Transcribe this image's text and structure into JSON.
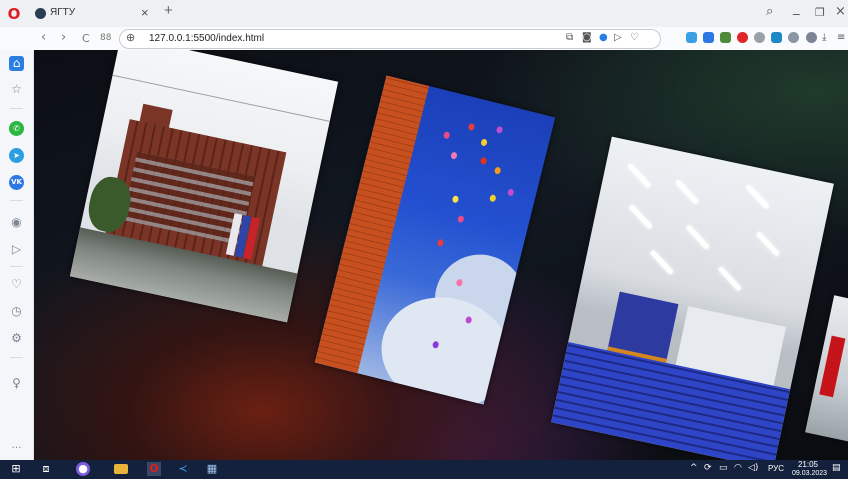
{
  "browser": {
    "tab_title": "ЯГТУ",
    "tab_close": "×",
    "new_tab": "+",
    "url": "127.0.0.1:5500/index.html",
    "window_controls": {
      "search": "⌕",
      "minimize": "_",
      "restore": "❐",
      "close": "×"
    },
    "nav": {
      "back": "‹",
      "forward": "›",
      "reload": "C",
      "speed_dial": "88"
    }
  },
  "sidebar": {
    "items": [
      {
        "name": "home-icon",
        "glyph": "⌂"
      },
      {
        "name": "star-icon",
        "glyph": "☆"
      },
      {
        "name": "whatsapp-icon",
        "glyph": "✆"
      },
      {
        "name": "telegram-icon",
        "glyph": "➤"
      },
      {
        "name": "vk-icon",
        "glyph": "VK"
      },
      {
        "name": "player-icon",
        "glyph": "▶"
      },
      {
        "name": "send-icon",
        "glyph": "▷"
      },
      {
        "name": "heart-icon",
        "glyph": "♡"
      },
      {
        "name": "history-icon",
        "glyph": "◷"
      },
      {
        "name": "settings-icon",
        "glyph": "⚙"
      },
      {
        "name": "bulb-icon",
        "glyph": "♀"
      },
      {
        "name": "more-icon",
        "glyph": "…"
      }
    ]
  },
  "colors": {
    "accent": "#2a7de1",
    "whatsapp": "#2bb741",
    "telegram": "#2b9fe0",
    "vk": "#2e78e6",
    "opera": "#e11b22",
    "taskbar": "#14213d"
  },
  "taskbar": {
    "language": "РУС",
    "time": "21:05",
    "date": "09.03.2023"
  }
}
